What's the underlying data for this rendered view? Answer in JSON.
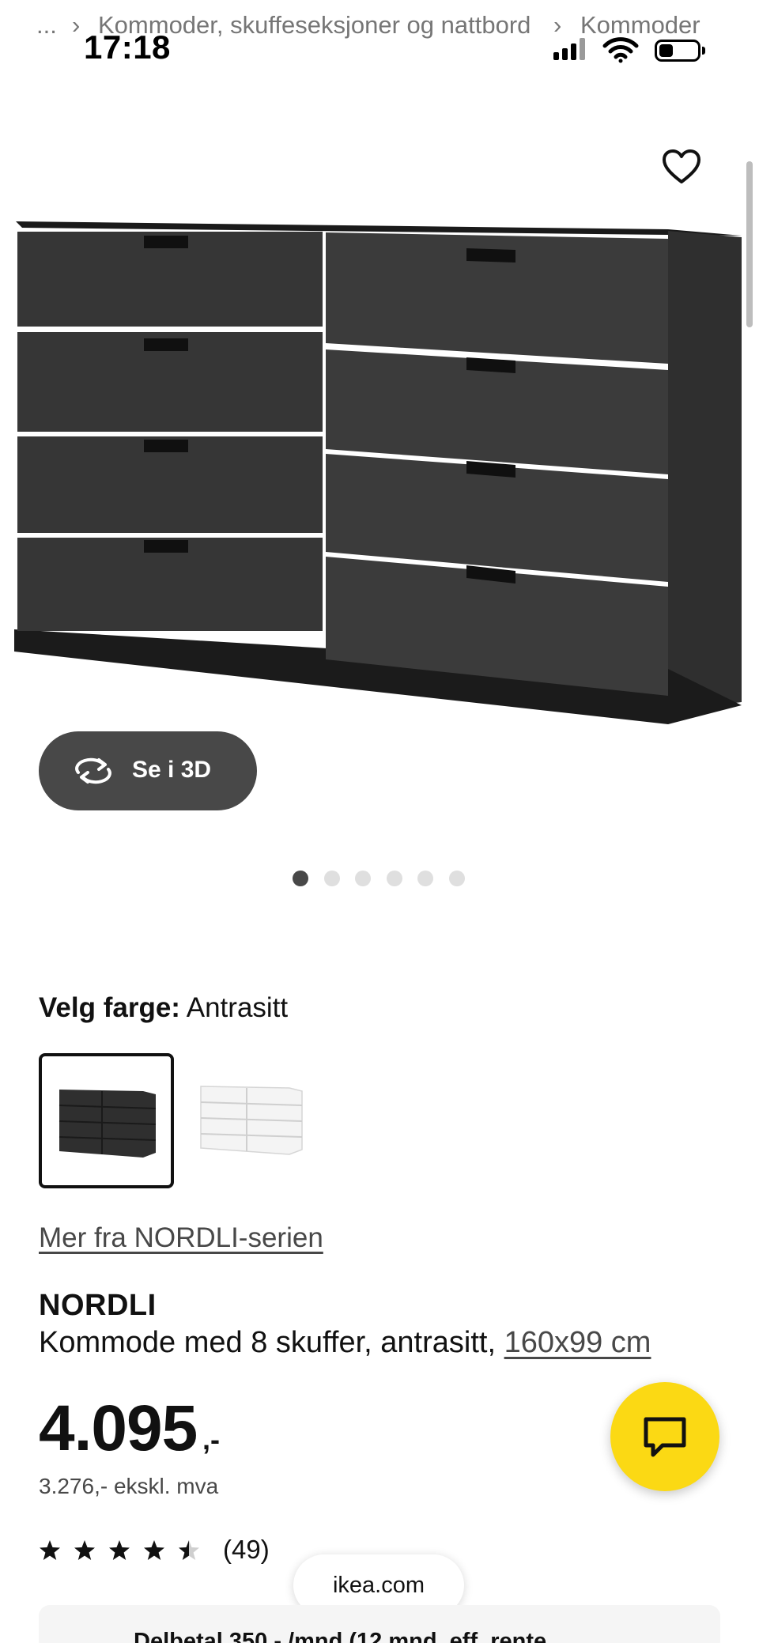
{
  "breadcrumb": {
    "ellipsis": "...",
    "separator": "›",
    "items": [
      "Kommoder, skuffeseksjoner og nattbord",
      "Kommoder"
    ]
  },
  "status_bar": {
    "time": "17:18"
  },
  "gallery": {
    "view_3d_label": "Se i 3D",
    "image_count": 6,
    "active_index": 0
  },
  "color": {
    "prefix": "Velg farge:",
    "selected": "Antrasitt",
    "options": [
      {
        "name": "Antrasitt",
        "swatch": "#2b2b2b",
        "selected": true
      },
      {
        "name": "Hvit",
        "swatch": "#f4f4f4",
        "selected": false
      }
    ]
  },
  "series_link": "Mer fra NORDLI-serien",
  "product": {
    "brand": "NORDLI",
    "description": "Kommode med 8 skuffer, antrasitt,",
    "size_link": "160x99 cm"
  },
  "price": {
    "amount": "4.095",
    "suffix": ",-",
    "excl_vat": "3.276,- ekskl. mva"
  },
  "rating": {
    "stars": 4.5,
    "max": 5,
    "count": "(49)"
  },
  "browser": {
    "url": "ikea.com"
  },
  "finance": {
    "text": "Delbetal 350,- /mnd (12 mnd, eff. rente"
  },
  "colors": {
    "accent_yellow": "#fbd914",
    "dark_button": "#484848",
    "text": "#111111"
  }
}
